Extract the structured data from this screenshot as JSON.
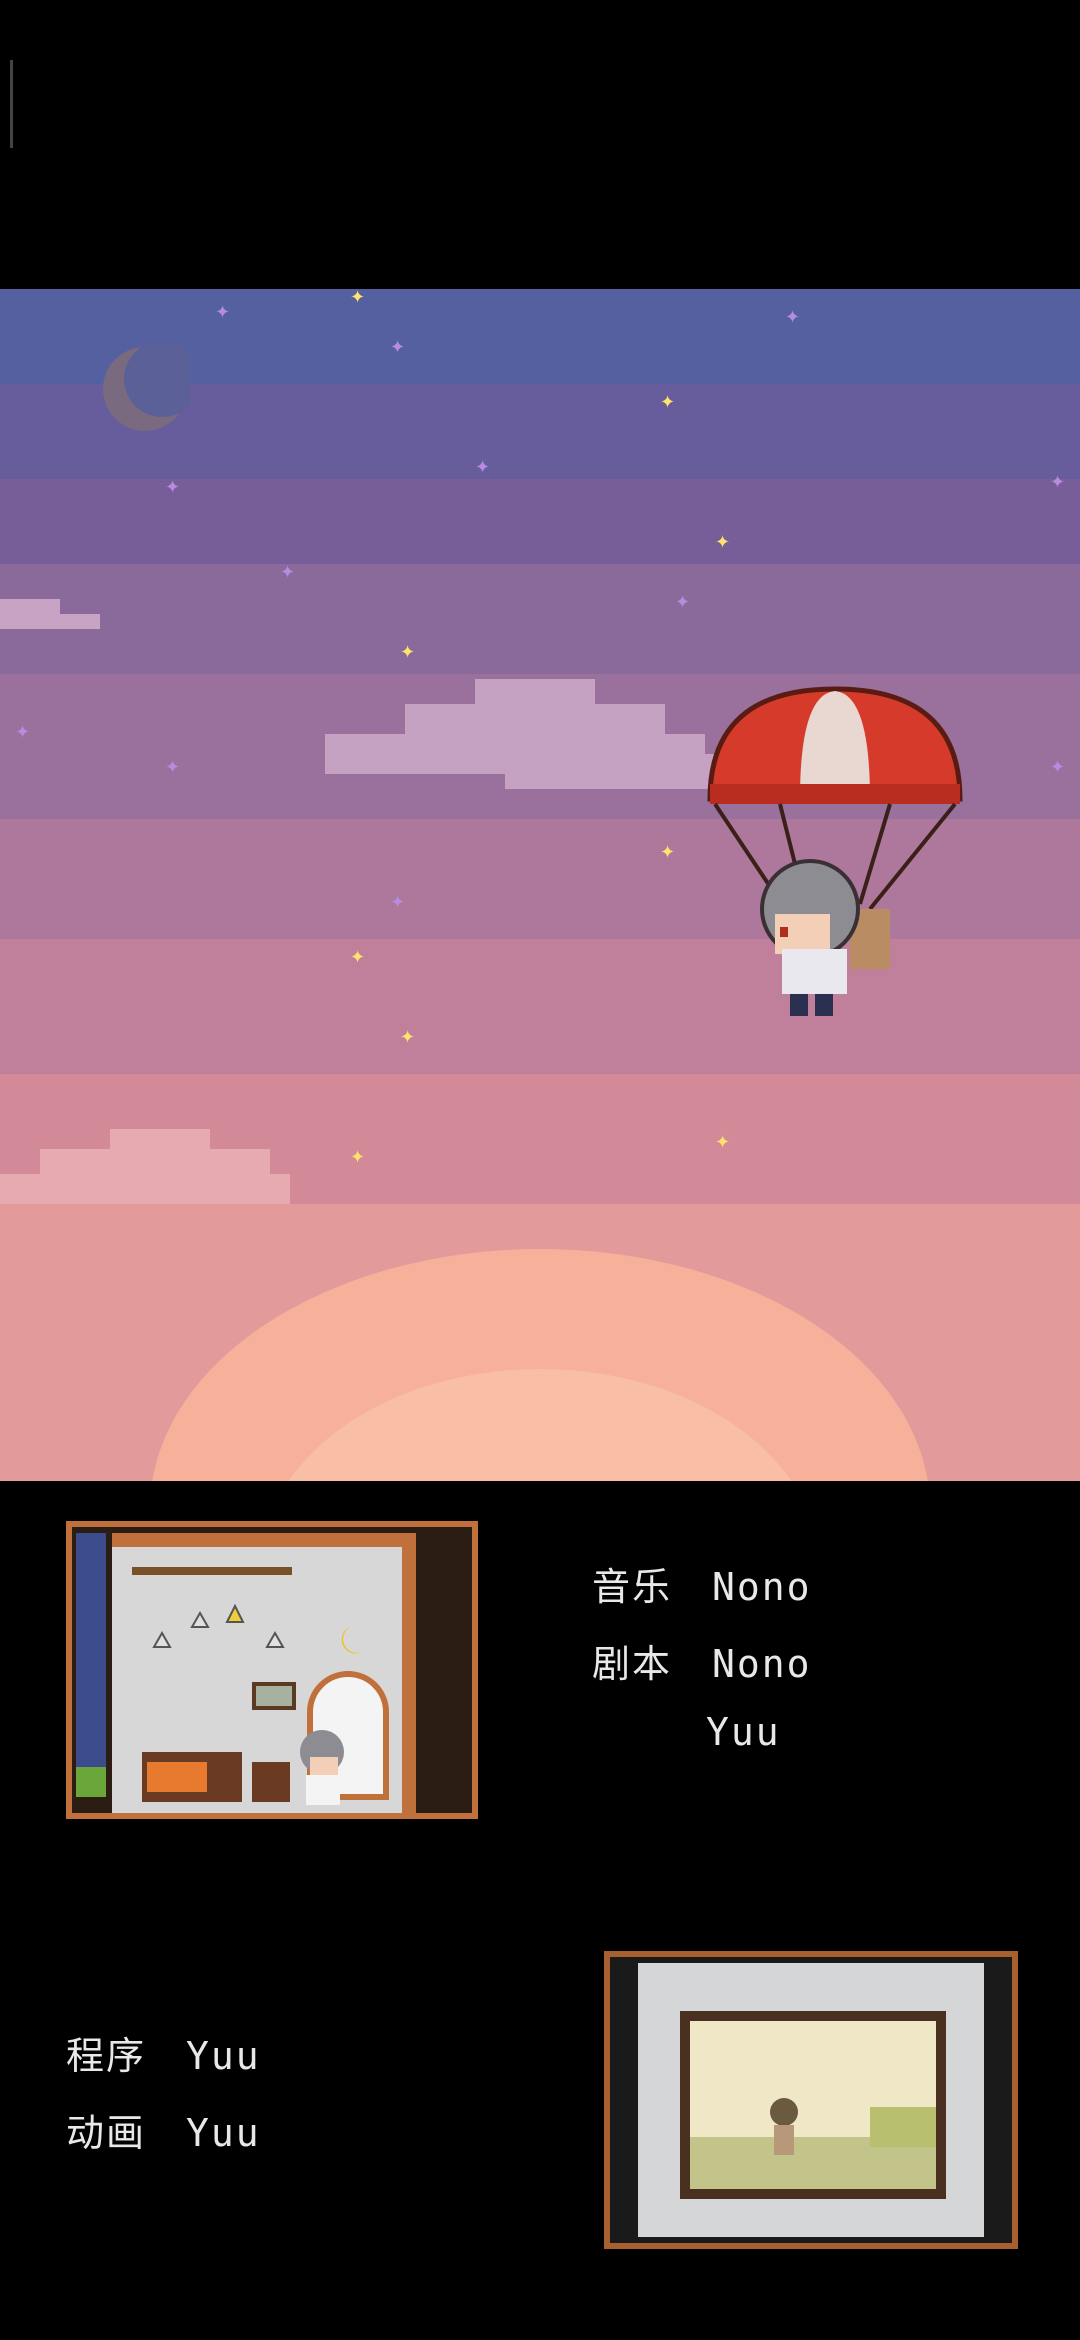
{
  "credits": {
    "music": {
      "role": "音乐",
      "name": "Nono"
    },
    "script": {
      "role": "剧本",
      "names": [
        "Nono",
        "Yuu"
      ]
    },
    "program": {
      "role": "程序",
      "name": "Yuu"
    },
    "animation": {
      "role": "动画",
      "name": "Yuu"
    }
  },
  "colors": {
    "sky_top": "#5460a0",
    "sky_mid": "#8f6a9e",
    "sky_pink": "#d9889b",
    "sun": "#f7b19a",
    "frame": "#c0703a"
  }
}
